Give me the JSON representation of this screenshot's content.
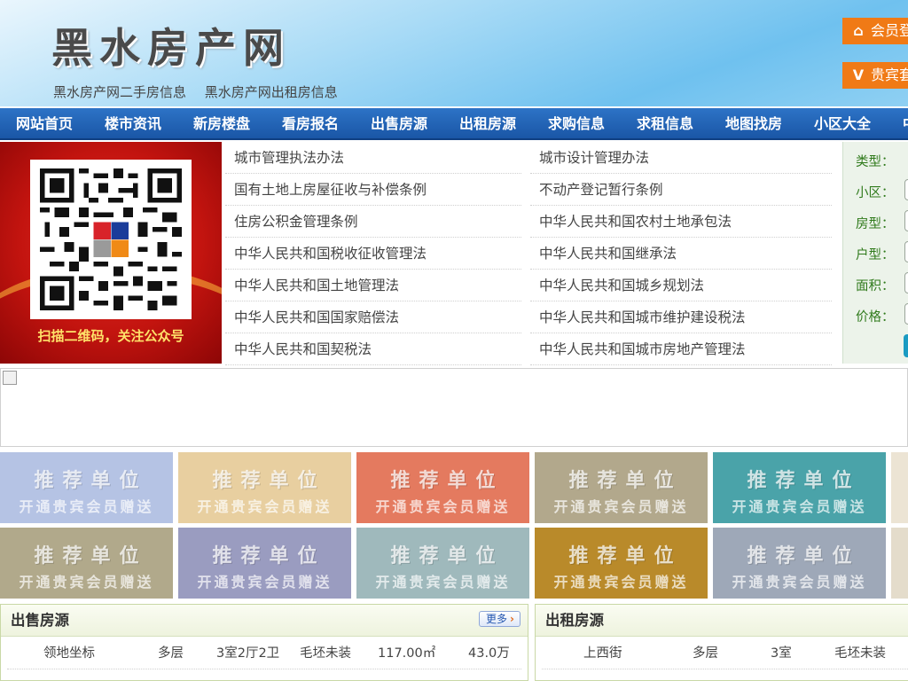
{
  "header": {
    "logo": "黑水房产网",
    "links": [
      "黑水房产网二手房信息",
      "黑水房产网出租房信息"
    ],
    "login_btn": "会员登录",
    "vip_btn": "贵宾套餐"
  },
  "nav": {
    "items": [
      "网站首页",
      "楼市资讯",
      "新房楼盘",
      "看房报名",
      "出售房源",
      "出租房源",
      "求购信息",
      "求租信息",
      "地图找房",
      "小区大全",
      "中"
    ]
  },
  "qr": {
    "caption": "扫描二维码，关注公众号"
  },
  "laws": [
    "城市管理执法办法",
    "城市设计管理办法",
    "国有土地上房屋征收与补偿条例",
    "不动产登记暂行条例",
    "住房公积金管理条例",
    "中华人民共和国农村土地承包法",
    "中华人民共和国税收征收管理法",
    "中华人民共和国继承法",
    "中华人民共和国土地管理法",
    "中华人民共和国城乡规划法",
    "中华人民共和国国家赔偿法",
    "中华人民共和国城市维护建设税法",
    "中华人民共和国契税法",
    "中华人民共和国城市房地产管理法"
  ],
  "search": {
    "labels": [
      "类型：",
      "小区：",
      "房型：",
      "户型：",
      "面积：",
      "价格："
    ]
  },
  "recommend": {
    "title": "推荐单位",
    "subtitle": "开通贵宾会员赠送",
    "colors": [
      [
        "#b5c3e4",
        "#e8cfa0",
        "#e47a5f",
        "#b2a88c",
        "#4aa3a9",
        "#ece4d4"
      ],
      [
        "#b1a98b",
        "#9a9cc0",
        "#9fb9bc",
        "#b98a2a",
        "#9ea8b8",
        "#e4dccb"
      ]
    ]
  },
  "sale": {
    "title": "出售房源",
    "more": "更多",
    "rows": [
      [
        "领地坐标",
        "多层",
        "3室2厅2卫",
        "毛坯未装",
        "117.00㎡",
        "43.0万"
      ]
    ]
  },
  "rent": {
    "title": "出租房源",
    "rows": [
      [
        "上西街",
        "多层",
        "3室",
        "毛坯未装"
      ]
    ]
  }
}
